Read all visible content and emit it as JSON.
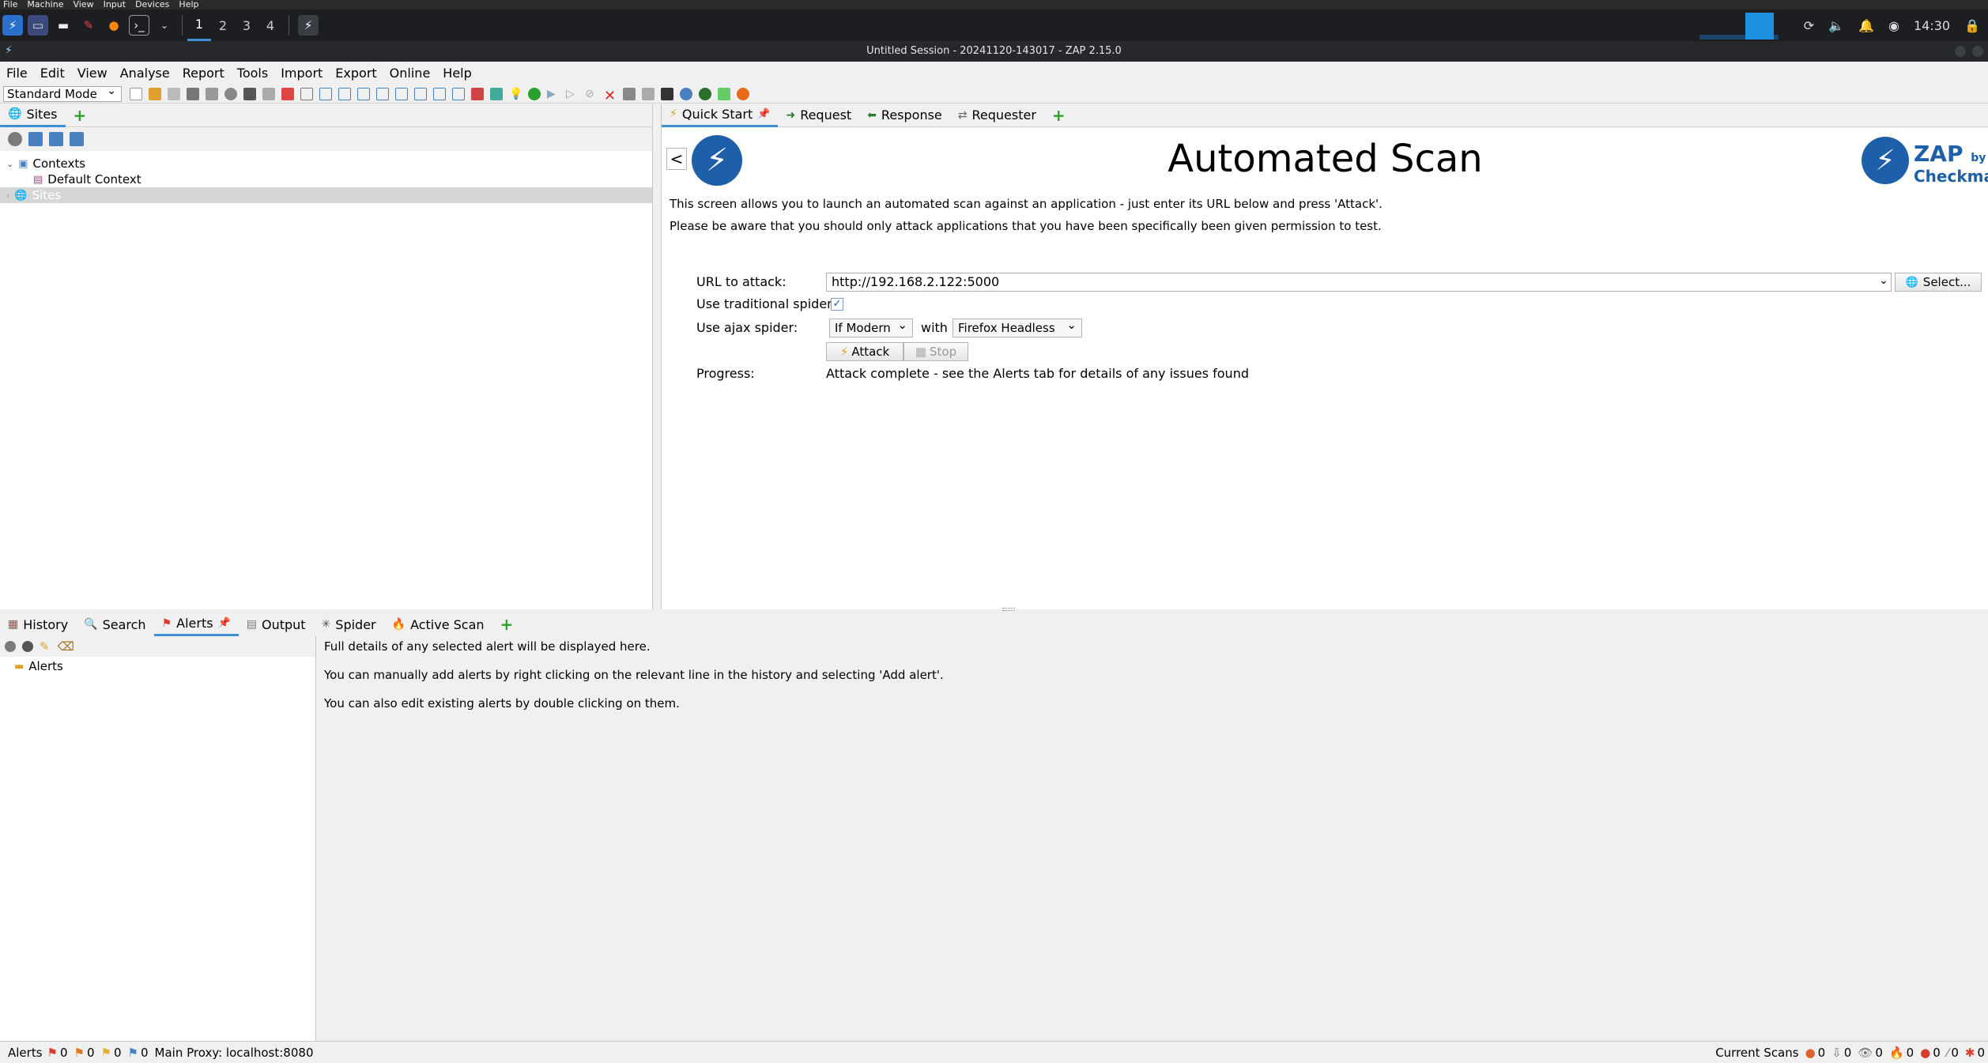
{
  "vm_menu": [
    "File",
    "Machine",
    "View",
    "Input",
    "Devices",
    "Help"
  ],
  "taskbar": {
    "workspaces": [
      "1",
      "2",
      "3",
      "4"
    ],
    "clock": "14:30"
  },
  "window": {
    "title": "Untitled Session - 20241120-143017 - ZAP 2.15.0"
  },
  "menubar": [
    "File",
    "Edit",
    "View",
    "Analyse",
    "Report",
    "Tools",
    "Import",
    "Export",
    "Online",
    "Help"
  ],
  "toolbar": {
    "mode": "Standard Mode"
  },
  "sites_panel": {
    "tab": "Sites",
    "tree": {
      "contexts": "Contexts",
      "default_context": "Default Context",
      "sites": "Sites"
    }
  },
  "work_tabs": [
    {
      "label": "Quick Start",
      "icon": "lightning-icon"
    },
    {
      "label": "Request",
      "icon": "arrow-right-icon"
    },
    {
      "label": "Response",
      "icon": "arrow-left-icon"
    },
    {
      "label": "Requester",
      "icon": "requester-icon"
    }
  ],
  "quick_start": {
    "back": "<",
    "heading": "Automated Scan",
    "logo_text_top": "ZAP",
    "logo_text_by": "by",
    "logo_text_bottom": "Checkma",
    "intro1": "This screen allows you to launch an automated scan against  an application - just enter its URL below and press 'Attack'.",
    "intro2": "Please be aware that you should only attack applications that you have been specifically been given permission to test.",
    "url_label": "URL to attack:",
    "url_value": "http://192.168.2.122:5000",
    "select_button": "Select...",
    "trad_spider_label": "Use traditional spider:",
    "trad_spider_checked": true,
    "ajax_label": "Use ajax spider:",
    "ajax_mode": "If Modern",
    "with_label": "with",
    "browser": "Firefox Headless",
    "attack_button": "Attack",
    "stop_button": "Stop",
    "progress_label": "Progress:",
    "progress_value": "Attack complete - see the Alerts tab for details of any issues found"
  },
  "bottom_tabs": [
    {
      "label": "History",
      "icon": "history-icon"
    },
    {
      "label": "Search",
      "icon": "search-icon"
    },
    {
      "label": "Alerts",
      "icon": "flag-icon"
    },
    {
      "label": "Output",
      "icon": "output-icon"
    },
    {
      "label": "Spider",
      "icon": "spider-icon"
    },
    {
      "label": "Active Scan",
      "icon": "flame-icon"
    }
  ],
  "alerts": {
    "tree_root": "Alerts",
    "detail1": "Full details of any selected alert will be displayed here.",
    "detail2": "You can manually add alerts by right clicking on the relevant line in the history and selecting 'Add alert'.",
    "detail3": "You can also edit existing alerts by double clicking on them."
  },
  "statusbar": {
    "alerts_label": "Alerts",
    "counts": [
      "0",
      "0",
      "0",
      "0"
    ],
    "proxy": "Main Proxy: localhost:8080",
    "current_scans_label": "Current Scans",
    "scan_counts": [
      "0",
      "0",
      "0",
      "0",
      "0",
      "0",
      "0"
    ]
  },
  "colors": {
    "accent": "#3d8fd8",
    "zap_blue": "#1d5fa8",
    "plus_green": "#2ca02c",
    "flag_red": "#d83b2b"
  }
}
